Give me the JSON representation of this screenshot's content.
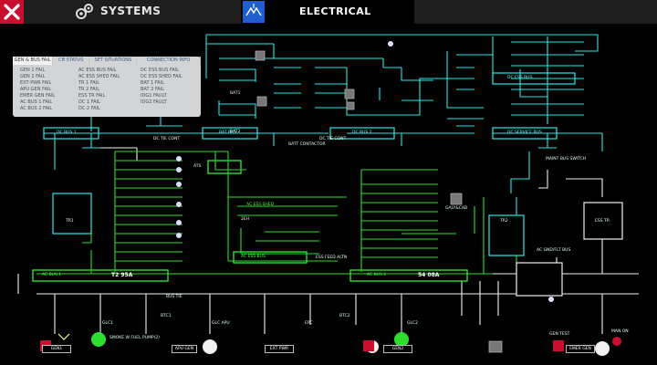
{
  "header": {
    "systems_label": "SYSTEMS",
    "electrical_label": "ELECTRICAL"
  },
  "fail_panel": {
    "tabs": [
      "GEN & BUS FAIL",
      "CB STATUS",
      "SET SITUATIONS",
      "CONNECTION INFO"
    ],
    "col1": [
      "GEN 1 FAIL",
      "GEN 2 FAIL",
      "EXT PWR FAIL",
      "APU GEN FAIL",
      "EMER GEN FAIL",
      "AC BUS 1 FAIL",
      "AC BUS 2 FAIL"
    ],
    "col2": [
      "AC ESS BUS FAIL",
      "AC ESS SHED FAIL",
      "TR 1 FAIL",
      "TR 2 FAIL",
      "ESS TR FAIL",
      "DC 1 FAIL",
      "DC 2 FAIL"
    ],
    "col3": [
      "DC ESS BUS FAIL",
      "DC ESS SHED FAIL",
      "BAT 1 FAIL",
      "BAT 2 FAIL",
      "IDG1 FAULT",
      "IDG2 FAULT"
    ]
  },
  "diagram_labels": {
    "dc_bus_1": "DC BUS 1",
    "dc_bat_bus": "BAT BUS",
    "dc_bus_2": "DC BUS 2",
    "dc_service_bus": "DC SERVICE BUS",
    "dc_ess_bus": "DC ESS BUS",
    "dc_tie_cont_1": "DC TIE CONT",
    "dc_tie_cont_2": "DC TIE CONT",
    "ac_bus_1": "AC BUS 1",
    "ac_bus_2": "AC BUS 2",
    "ac_bus_1_value": "T2 95A",
    "ac_bus_2_value": "54 08A",
    "ac_ess_bus": "AC ESS BUS",
    "ac_ess_shed": "AC ESS SHED",
    "ac_gnd_flt_bus": "AC GND/FLT BUS",
    "tr1": "TR1",
    "tr2": "TR2",
    "ess_tr": "ESS TR",
    "bat1": "BAT1",
    "bat2": "BAT2",
    "galy": "GALY&CAB",
    "gen1": "GEN1",
    "gen2": "GEN2",
    "apu_gen": "APU GEN",
    "ext_pwr": "EXT PWR",
    "emer_gen": "EMER GEN",
    "man_on": "MAN ON",
    "smoke": "SMOKE W FUEL PUMP(2)",
    "bus_tie": "BUS TIE",
    "mant_bus_switch": "MAINT BUS SWITCH",
    "gen_test": "GEN TEST",
    "ess_feed_altn": "ESS FEED ALTN",
    "lbls_gen1": "GLC1",
    "lbls_gen2": "GLC2",
    "lbls_apu": "GLC APU",
    "lbls_ext": "EPC",
    "bustie1": "BTC1",
    "bustie2": "BTC2",
    "ats": "ATS",
    "batcont": "BATT CONTACTOR",
    "k2": "2EH"
  },
  "colors": {
    "dc_line": "#25e8e8",
    "ac_line": "#2dde2d",
    "white_line": "#f0f0f0",
    "close_bg": "#c8102e",
    "tab_blue": "#1f5fd0"
  },
  "icons": [
    "close-icon",
    "gears-icon",
    "electrical-icon"
  ]
}
